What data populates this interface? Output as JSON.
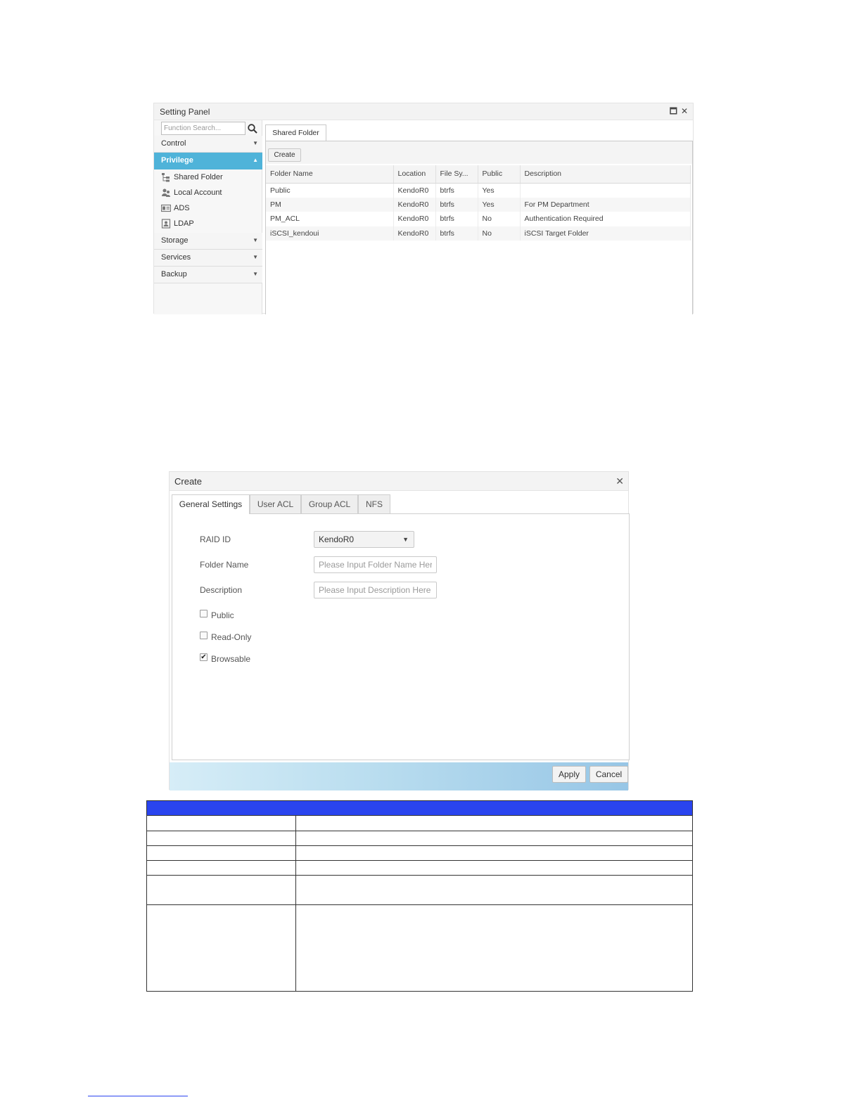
{
  "setting_panel": {
    "title": "Setting Panel",
    "search_placeholder": "Function Search...",
    "nav": {
      "control": "Control",
      "privilege": "Privilege",
      "privilege_items": [
        "Shared Folder",
        "Local Account",
        "ADS",
        "LDAP"
      ],
      "storage": "Storage",
      "services": "Services",
      "backup": "Backup"
    },
    "tab": "Shared Folder",
    "create_label": "Create",
    "columns": [
      "Folder Name",
      "Location",
      "File Sy...",
      "Public",
      "Description"
    ],
    "rows": [
      [
        "Public",
        "KendoR0",
        "btrfs",
        "Yes",
        ""
      ],
      [
        "PM",
        "KendoR0",
        "btrfs",
        "Yes",
        "For PM Department"
      ],
      [
        "PM_ACL",
        "KendoR0",
        "btrfs",
        "No",
        "Authentication Required"
      ],
      [
        "iSCSI_kendoui",
        "KendoR0",
        "btrfs",
        "No",
        "iSCSI Target Folder"
      ]
    ]
  },
  "create_dialog": {
    "title": "Create",
    "tabs": [
      "General Settings",
      "User ACL",
      "Group ACL",
      "NFS"
    ],
    "raid_label": "RAID ID",
    "raid_value": "KendoR0",
    "folder_name_label": "Folder Name",
    "folder_name_placeholder": "Please Input Folder Name Here",
    "description_label": "Description",
    "description_placeholder": "Please Input Description Here",
    "checkboxes": [
      {
        "label": "Public",
        "checked": false
      },
      {
        "label": "Read-Only",
        "checked": false
      },
      {
        "label": "Browsable",
        "checked": true
      }
    ],
    "apply_label": "Apply",
    "cancel_label": "Cancel"
  },
  "colors": {
    "accent": "#4fb3d9",
    "table_header": "#2a44ef",
    "link": "#2a44ef"
  }
}
